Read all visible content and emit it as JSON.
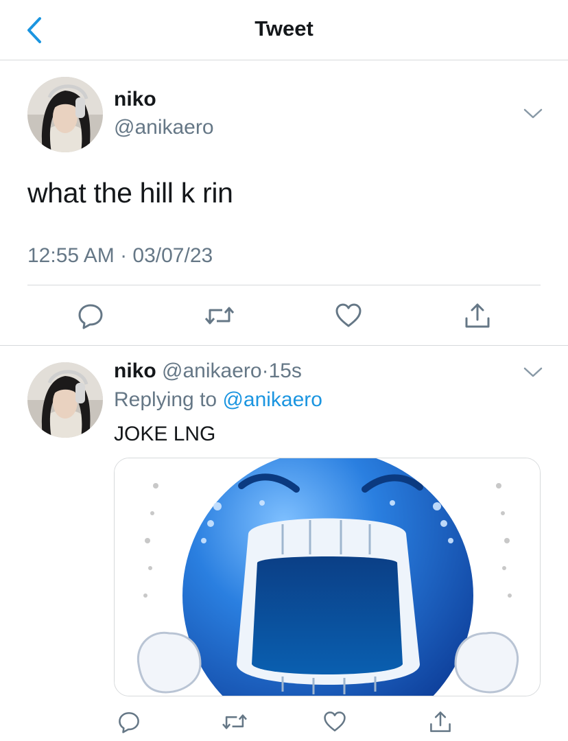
{
  "header": {
    "title": "Tweet",
    "back_icon": "chevron-left-icon"
  },
  "colors": {
    "accent": "#1b95e0",
    "text": "#14171a",
    "secondary": "#657786",
    "divider": "#d6d9db"
  },
  "main_tweet": {
    "name": "niko",
    "handle": "@anikaero",
    "text": "what the hill k rin",
    "timestamp": "12:55 AM · 03/07/23",
    "menu_icon": "chevron-down-icon",
    "actions": [
      "reply-icon",
      "retweet-icon",
      "like-icon",
      "share-icon"
    ]
  },
  "reply_tweet": {
    "name": "niko",
    "handle": "@anikaero",
    "separator": "·",
    "age": "15s",
    "replying_prefix": "Replying to",
    "replying_to": "@anikaero",
    "text": "JOKE LNG",
    "media": "crying-blue-emoji-image",
    "menu_icon": "chevron-down-icon",
    "actions": [
      "reply-icon",
      "retweet-icon",
      "like-icon",
      "share-icon"
    ]
  }
}
